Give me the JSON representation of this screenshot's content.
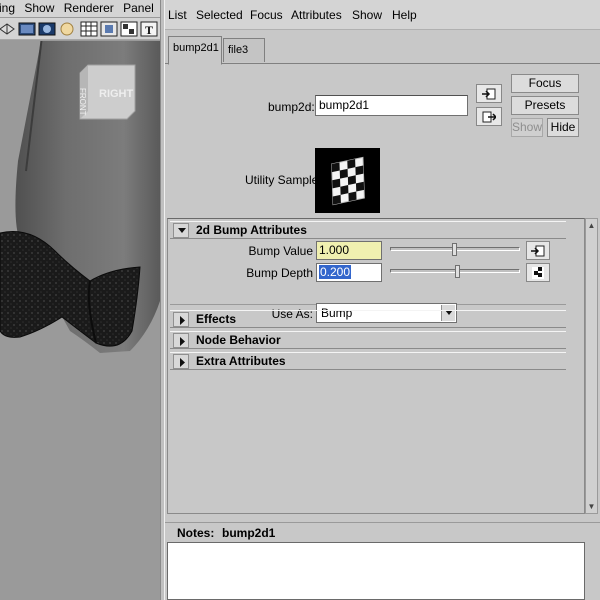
{
  "viewport": {
    "menu": [
      "nting",
      "Show",
      "Renderer",
      "Panel"
    ],
    "toolbar_icons": [
      "wireframe-shaded-icon",
      "shaded-icon",
      "textured-icon",
      "lighting-icon",
      "xray-icon",
      "isolate-icon",
      "grid-texture-icon",
      "text-icon"
    ],
    "viewcube_label": "RIGHT"
  },
  "editor": {
    "menu": [
      "List",
      "Selected",
      "Focus",
      "Attributes",
      "Show",
      "Help"
    ],
    "tabs": [
      {
        "label": "bump2d1",
        "active": true
      },
      {
        "label": "file3",
        "active": false
      }
    ],
    "node_label": "bump2d:",
    "node_name": "bump2d1",
    "buttons": {
      "focus": "Focus",
      "presets": "Presets",
      "show": "Show",
      "hide": "Hide"
    },
    "swatch_label": "Utility Sample",
    "sections": [
      {
        "title": "2d Bump Attributes",
        "expanded": true
      },
      {
        "title": "Effects",
        "expanded": false
      },
      {
        "title": "Node Behavior",
        "expanded": false
      },
      {
        "title": "Extra Attributes",
        "expanded": false
      }
    ],
    "attributes": {
      "bump_value": {
        "label": "Bump Value",
        "value": "1.000",
        "slider": 0.5
      },
      "bump_depth": {
        "label": "Bump Depth",
        "value": "0.200",
        "slider": 0.52
      },
      "use_as": {
        "label": "Use As:",
        "selected": "Bump"
      }
    },
    "notes": {
      "label": "Notes:",
      "node": "bump2d1",
      "text": ""
    }
  }
}
